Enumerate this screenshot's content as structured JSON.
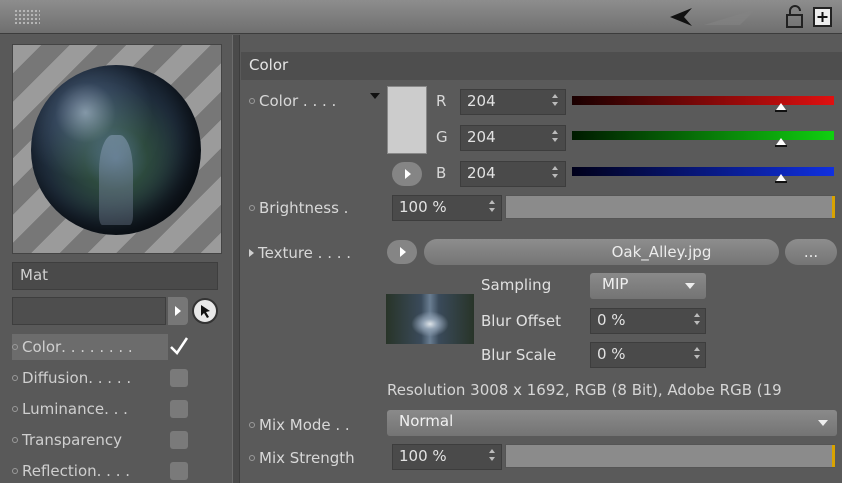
{
  "material": {
    "name": "Mat",
    "channels": [
      {
        "label": "Color",
        "dots": " . . . . . . . .",
        "checked": true
      },
      {
        "label": "Diffusion",
        "dots": ". . . . .",
        "checked": false
      },
      {
        "label": "Luminance",
        "dots": " . . .",
        "checked": false
      },
      {
        "label": "Transparency",
        "dots": "",
        "checked": false
      },
      {
        "label": "Reflection",
        "dots": " . . . .",
        "checked": false
      }
    ]
  },
  "section": {
    "title": "Color"
  },
  "color": {
    "label": "Color . . . .",
    "swatch": "#cccccc",
    "r_label": "R",
    "r_value": "204",
    "r_fraction": 0.8,
    "g_label": "G",
    "g_value": "204",
    "g_fraction": 0.8,
    "b_label": "B",
    "b_value": "204",
    "b_fraction": 0.8
  },
  "brightness": {
    "label": "Brightness  .",
    "value": "100 %",
    "fraction": 1.0
  },
  "texture": {
    "label": "Texture  . . . .",
    "file": "Oak_Alley.jpg",
    "more_label": "...",
    "sampling_label": "Sampling",
    "sampling_value": "MIP",
    "blur_offset_label": "Blur Offset",
    "blur_offset_value": "0 %",
    "blur_scale_label": "Blur Scale",
    "blur_scale_value": "0 %",
    "resolution": "Resolution 3008 x 1692, RGB (8 Bit), Adobe RGB (19"
  },
  "mix_mode": {
    "label": "Mix Mode . .",
    "value": "Normal"
  },
  "mix_strength": {
    "label": "Mix Strength",
    "value": "100 %",
    "fraction": 1.0
  },
  "colors": {
    "accent": "#d9a300",
    "red": "#e01010",
    "green": "#10d010",
    "blue": "#1030e0"
  },
  "icons": [
    "grip-icon",
    "back-arrow-icon",
    "lock-icon",
    "new-window-icon",
    "picker-icon",
    "checkmark-icon"
  ]
}
